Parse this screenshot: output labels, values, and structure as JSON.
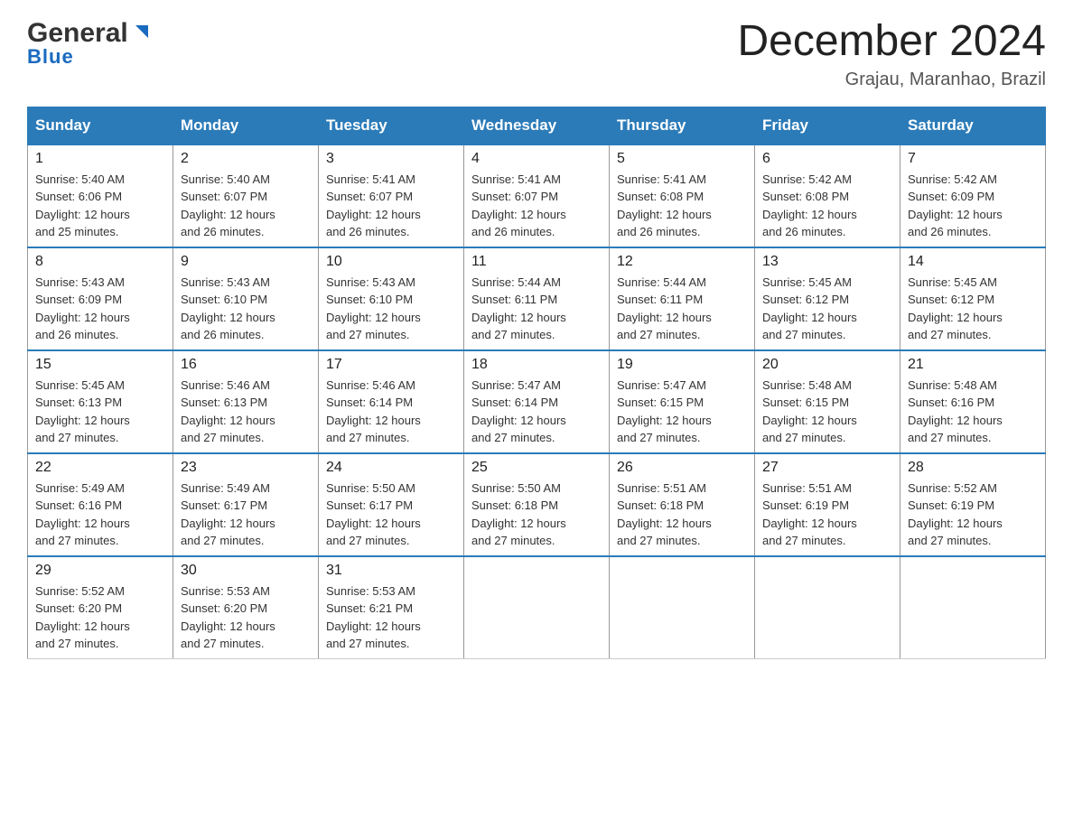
{
  "header": {
    "logo_general": "General",
    "logo_blue": "Blue",
    "month_title": "December 2024",
    "location": "Grajau, Maranhao, Brazil"
  },
  "days_of_week": [
    "Sunday",
    "Monday",
    "Tuesday",
    "Wednesday",
    "Thursday",
    "Friday",
    "Saturday"
  ],
  "weeks": [
    [
      {
        "day": "1",
        "sunrise": "5:40 AM",
        "sunset": "6:06 PM",
        "daylight": "12 hours and 25 minutes."
      },
      {
        "day": "2",
        "sunrise": "5:40 AM",
        "sunset": "6:07 PM",
        "daylight": "12 hours and 26 minutes."
      },
      {
        "day": "3",
        "sunrise": "5:41 AM",
        "sunset": "6:07 PM",
        "daylight": "12 hours and 26 minutes."
      },
      {
        "day": "4",
        "sunrise": "5:41 AM",
        "sunset": "6:07 PM",
        "daylight": "12 hours and 26 minutes."
      },
      {
        "day": "5",
        "sunrise": "5:41 AM",
        "sunset": "6:08 PM",
        "daylight": "12 hours and 26 minutes."
      },
      {
        "day": "6",
        "sunrise": "5:42 AM",
        "sunset": "6:08 PM",
        "daylight": "12 hours and 26 minutes."
      },
      {
        "day": "7",
        "sunrise": "5:42 AM",
        "sunset": "6:09 PM",
        "daylight": "12 hours and 26 minutes."
      }
    ],
    [
      {
        "day": "8",
        "sunrise": "5:43 AM",
        "sunset": "6:09 PM",
        "daylight": "12 hours and 26 minutes."
      },
      {
        "day": "9",
        "sunrise": "5:43 AM",
        "sunset": "6:10 PM",
        "daylight": "12 hours and 26 minutes."
      },
      {
        "day": "10",
        "sunrise": "5:43 AM",
        "sunset": "6:10 PM",
        "daylight": "12 hours and 27 minutes."
      },
      {
        "day": "11",
        "sunrise": "5:44 AM",
        "sunset": "6:11 PM",
        "daylight": "12 hours and 27 minutes."
      },
      {
        "day": "12",
        "sunrise": "5:44 AM",
        "sunset": "6:11 PM",
        "daylight": "12 hours and 27 minutes."
      },
      {
        "day": "13",
        "sunrise": "5:45 AM",
        "sunset": "6:12 PM",
        "daylight": "12 hours and 27 minutes."
      },
      {
        "day": "14",
        "sunrise": "5:45 AM",
        "sunset": "6:12 PM",
        "daylight": "12 hours and 27 minutes."
      }
    ],
    [
      {
        "day": "15",
        "sunrise": "5:45 AM",
        "sunset": "6:13 PM",
        "daylight": "12 hours and 27 minutes."
      },
      {
        "day": "16",
        "sunrise": "5:46 AM",
        "sunset": "6:13 PM",
        "daylight": "12 hours and 27 minutes."
      },
      {
        "day": "17",
        "sunrise": "5:46 AM",
        "sunset": "6:14 PM",
        "daylight": "12 hours and 27 minutes."
      },
      {
        "day": "18",
        "sunrise": "5:47 AM",
        "sunset": "6:14 PM",
        "daylight": "12 hours and 27 minutes."
      },
      {
        "day": "19",
        "sunrise": "5:47 AM",
        "sunset": "6:15 PM",
        "daylight": "12 hours and 27 minutes."
      },
      {
        "day": "20",
        "sunrise": "5:48 AM",
        "sunset": "6:15 PM",
        "daylight": "12 hours and 27 minutes."
      },
      {
        "day": "21",
        "sunrise": "5:48 AM",
        "sunset": "6:16 PM",
        "daylight": "12 hours and 27 minutes."
      }
    ],
    [
      {
        "day": "22",
        "sunrise": "5:49 AM",
        "sunset": "6:16 PM",
        "daylight": "12 hours and 27 minutes."
      },
      {
        "day": "23",
        "sunrise": "5:49 AM",
        "sunset": "6:17 PM",
        "daylight": "12 hours and 27 minutes."
      },
      {
        "day": "24",
        "sunrise": "5:50 AM",
        "sunset": "6:17 PM",
        "daylight": "12 hours and 27 minutes."
      },
      {
        "day": "25",
        "sunrise": "5:50 AM",
        "sunset": "6:18 PM",
        "daylight": "12 hours and 27 minutes."
      },
      {
        "day": "26",
        "sunrise": "5:51 AM",
        "sunset": "6:18 PM",
        "daylight": "12 hours and 27 minutes."
      },
      {
        "day": "27",
        "sunrise": "5:51 AM",
        "sunset": "6:19 PM",
        "daylight": "12 hours and 27 minutes."
      },
      {
        "day": "28",
        "sunrise": "5:52 AM",
        "sunset": "6:19 PM",
        "daylight": "12 hours and 27 minutes."
      }
    ],
    [
      {
        "day": "29",
        "sunrise": "5:52 AM",
        "sunset": "6:20 PM",
        "daylight": "12 hours and 27 minutes."
      },
      {
        "day": "30",
        "sunrise": "5:53 AM",
        "sunset": "6:20 PM",
        "daylight": "12 hours and 27 minutes."
      },
      {
        "day": "31",
        "sunrise": "5:53 AM",
        "sunset": "6:21 PM",
        "daylight": "12 hours and 27 minutes."
      },
      null,
      null,
      null,
      null
    ]
  ],
  "labels": {
    "sunrise": "Sunrise:",
    "sunset": "Sunset:",
    "daylight": "Daylight:"
  }
}
